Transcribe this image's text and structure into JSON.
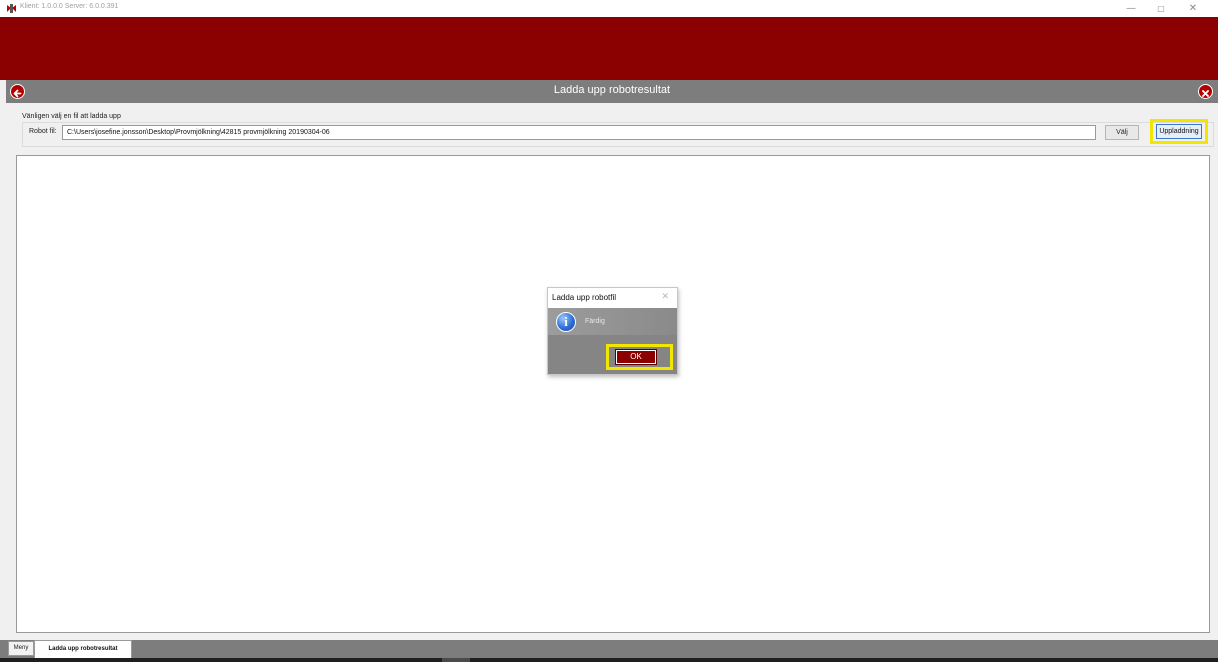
{
  "window": {
    "title": "Klient: 1.0.0.0 Server: 6.0.0.391",
    "controls": {
      "minimize": "—",
      "maximize": "▢",
      "close": "✕"
    }
  },
  "header": {
    "title": "Ladda upp robotresultat",
    "back_icon": "arrow-left-circle-icon",
    "close_icon": "close-circle-icon"
  },
  "form": {
    "prompt": "Vänligen välj en fil att ladda upp",
    "robot_label": "Robot fil:",
    "robot_path": "C:\\Users\\josefine.jonsson\\Desktop\\Provmjölkning\\42815 provmjölkning 20190304-06",
    "choose_button": "Välj",
    "upload_button": "Uppladdning"
  },
  "dialog": {
    "title": "Ladda upp robotfil",
    "close": "✕",
    "message": "Färdig",
    "icon": "info-icon",
    "ok_button": "OK"
  },
  "tabs": [
    {
      "label": "Meny"
    },
    {
      "label": "Ladda upp robotresultat"
    }
  ],
  "colors": {
    "brand_red": "#8b0000",
    "header_gray": "#7d7d7d",
    "highlight_yellow": "#f2e600"
  }
}
